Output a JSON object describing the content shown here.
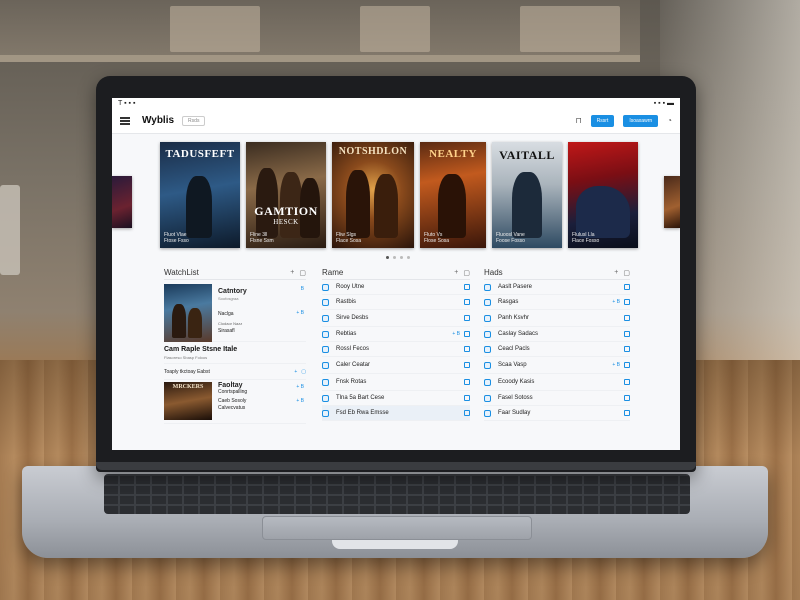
{
  "status_bar": {
    "left": "T ▪ ▪ ▪",
    "right": "▪ ▪ ▪ ▬"
  },
  "header": {
    "app_title": "Wyblis",
    "tab_label": "Rsds",
    "btn1": "Rssrt",
    "btn2": "Isoaxawrn"
  },
  "carousel": {
    "posters": [
      {
        "title": "",
        "meta": ""
      },
      {
        "title": "TADUSFEFT",
        "meta": "Fluot Vlae\nFtose Fsso"
      },
      {
        "title": "GAMTION",
        "subtitle": "HESCK",
        "meta": "Fline 3ll\nFlsne Ssm"
      },
      {
        "title": "NOTSHDLON",
        "meta": "Fliw Slgs\nFlace Sosa"
      },
      {
        "title": "NEALTY",
        "meta": "Fluto Vs\nFlose Sosa"
      },
      {
        "title": "VAITALL",
        "meta": "Fluoosl Vane\nFoose Fosso"
      },
      {
        "title": "",
        "meta": "Flulusl Lla\nFlace Fosso"
      },
      {
        "title": "",
        "meta": ""
      }
    ]
  },
  "colors": {
    "accent": "#1a8fe3"
  },
  "watchlist": {
    "title": "WatchList",
    "item1": {
      "t1": "Catntory",
      "t2": "Soofosgraa",
      "t3": "Naclga",
      "t4": "Clodaor Nazz",
      "t5": "Sirasafl",
      "right1": "B",
      "right2": "+ B"
    },
    "mid_title": "Cam Raple Stsne Itale",
    "mid_sub": "Flasoreso Sbasp Foloos",
    "section2_label": "Toaply tkctoay Eabst",
    "item2": {
      "t1": "Faoltay",
      "t2": "Conrtspalling",
      "t3": "Caeb Sosoly",
      "t4": "Calvecvatus",
      "right1": "+ B",
      "right2": "+ B",
      "thumb_text": "MRCKERS"
    }
  },
  "home": {
    "title": "Rame",
    "rows": [
      {
        "label": "Rooy Utne",
        "right": ""
      },
      {
        "label": "Rastbis",
        "right": ""
      },
      {
        "label": "Sirve Desbs",
        "right": ""
      },
      {
        "label": "Rebtias",
        "right": "+ B"
      },
      {
        "label": "Rossl Fecos",
        "right": ""
      },
      {
        "label": "Caler Ceatar",
        "right": ""
      },
      {
        "label": "Fnsk Rotas",
        "right": ""
      },
      {
        "label": "Tlna 5a Bart Cese",
        "right": ""
      },
      {
        "label": "Fsd Eb Rwa Emsse",
        "right": ""
      }
    ]
  },
  "lists": {
    "title": "Hads",
    "rows": [
      {
        "label": "Aaslt Pasere",
        "right": ""
      },
      {
        "label": "Rasgas",
        "right": "+ B"
      },
      {
        "label": "Panh Ksvhr",
        "right": ""
      },
      {
        "label": "Caslay Sadacs",
        "right": ""
      },
      {
        "label": "Ceacl Pacls",
        "right": ""
      },
      {
        "label": "Scaa Vasp",
        "right": "+ B"
      },
      {
        "label": "Ecoody Kasis",
        "right": ""
      },
      {
        "label": "Fasel Sotoss",
        "right": ""
      },
      {
        "label": "Faar Sudlay",
        "right": ""
      }
    ]
  }
}
